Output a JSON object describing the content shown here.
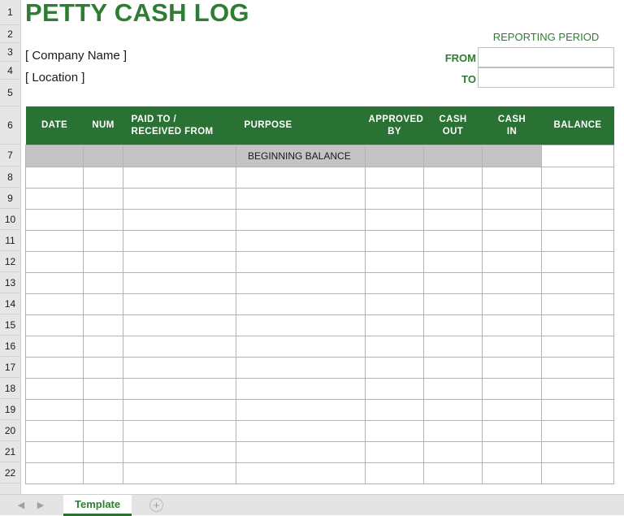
{
  "document": {
    "title": "PETTY CASH LOG",
    "company_placeholder": "[ Company Name ]",
    "location_placeholder": "[ Location ]"
  },
  "reporting_period": {
    "label": "REPORTING PERIOD",
    "from_label": "FROM",
    "to_label": "TO",
    "from_value": "",
    "to_value": ""
  },
  "table": {
    "columns": [
      "DATE",
      "NUM",
      "PAID TO /\nRECEIVED FROM",
      "PURPOSE",
      "APPROVED\nBY",
      "CASH\nOUT",
      "CASH\nIN",
      "BALANCE"
    ],
    "columns_display": {
      "date": "DATE",
      "num": "NUM",
      "paid_to_line1": "PAID TO /",
      "paid_to_line2": "RECEIVED FROM",
      "purpose": "PURPOSE",
      "approved_line1": "APPROVED",
      "approved_line2": "BY",
      "cash_out_line1": "CASH",
      "cash_out_line2": "OUT",
      "cash_in_line1": "CASH",
      "cash_in_line2": "IN",
      "balance": "BALANCE"
    },
    "beginning_balance_label": "BEGINNING BALANCE",
    "rows": [
      {
        "date": "",
        "num": "",
        "paid_to": "",
        "purpose": "",
        "approved_by": "",
        "cash_out": "",
        "cash_in": "",
        "balance": ""
      },
      {
        "date": "",
        "num": "",
        "paid_to": "",
        "purpose": "",
        "approved_by": "",
        "cash_out": "",
        "cash_in": "",
        "balance": ""
      },
      {
        "date": "",
        "num": "",
        "paid_to": "",
        "purpose": "",
        "approved_by": "",
        "cash_out": "",
        "cash_in": "",
        "balance": ""
      },
      {
        "date": "",
        "num": "",
        "paid_to": "",
        "purpose": "",
        "approved_by": "",
        "cash_out": "",
        "cash_in": "",
        "balance": ""
      },
      {
        "date": "",
        "num": "",
        "paid_to": "",
        "purpose": "",
        "approved_by": "",
        "cash_out": "",
        "cash_in": "",
        "balance": ""
      },
      {
        "date": "",
        "num": "",
        "paid_to": "",
        "purpose": "",
        "approved_by": "",
        "cash_out": "",
        "cash_in": "",
        "balance": ""
      },
      {
        "date": "",
        "num": "",
        "paid_to": "",
        "purpose": "",
        "approved_by": "",
        "cash_out": "",
        "cash_in": "",
        "balance": ""
      },
      {
        "date": "",
        "num": "",
        "paid_to": "",
        "purpose": "",
        "approved_by": "",
        "cash_out": "",
        "cash_in": "",
        "balance": ""
      },
      {
        "date": "",
        "num": "",
        "paid_to": "",
        "purpose": "",
        "approved_by": "",
        "cash_out": "",
        "cash_in": "",
        "balance": ""
      },
      {
        "date": "",
        "num": "",
        "paid_to": "",
        "purpose": "",
        "approved_by": "",
        "cash_out": "",
        "cash_in": "",
        "balance": ""
      },
      {
        "date": "",
        "num": "",
        "paid_to": "",
        "purpose": "",
        "approved_by": "",
        "cash_out": "",
        "cash_in": "",
        "balance": ""
      },
      {
        "date": "",
        "num": "",
        "paid_to": "",
        "purpose": "",
        "approved_by": "",
        "cash_out": "",
        "cash_in": "",
        "balance": ""
      },
      {
        "date": "",
        "num": "",
        "paid_to": "",
        "purpose": "",
        "approved_by": "",
        "cash_out": "",
        "cash_in": "",
        "balance": ""
      },
      {
        "date": "",
        "num": "",
        "paid_to": "",
        "purpose": "",
        "approved_by": "",
        "cash_out": "",
        "cash_in": "",
        "balance": ""
      },
      {
        "date": "",
        "num": "",
        "paid_to": "",
        "purpose": "",
        "approved_by": "",
        "cash_out": "",
        "cash_in": "",
        "balance": ""
      }
    ]
  },
  "spreadsheet": {
    "row_headers": [
      "1",
      "2",
      "3",
      "4",
      "5",
      "6",
      "7",
      "8",
      "9",
      "10",
      "11",
      "12",
      "13",
      "14",
      "15",
      "16",
      "17",
      "18",
      "19",
      "20",
      "21",
      "22"
    ],
    "tab_name": "Template",
    "prev_sheet_icon": "prev-arrow-icon",
    "next_sheet_icon": "next-arrow-icon",
    "add_sheet_icon": "plus-icon",
    "prev_glyph": "◀",
    "next_glyph": "▶",
    "add_glyph": "+"
  },
  "colors": {
    "header_green": "#2a7134",
    "title_green": "#2f7d32",
    "beginning_row_gray": "#c4c4c4",
    "gutter_gray": "#e6e6e6",
    "grid_line": "#b3b3b3"
  }
}
